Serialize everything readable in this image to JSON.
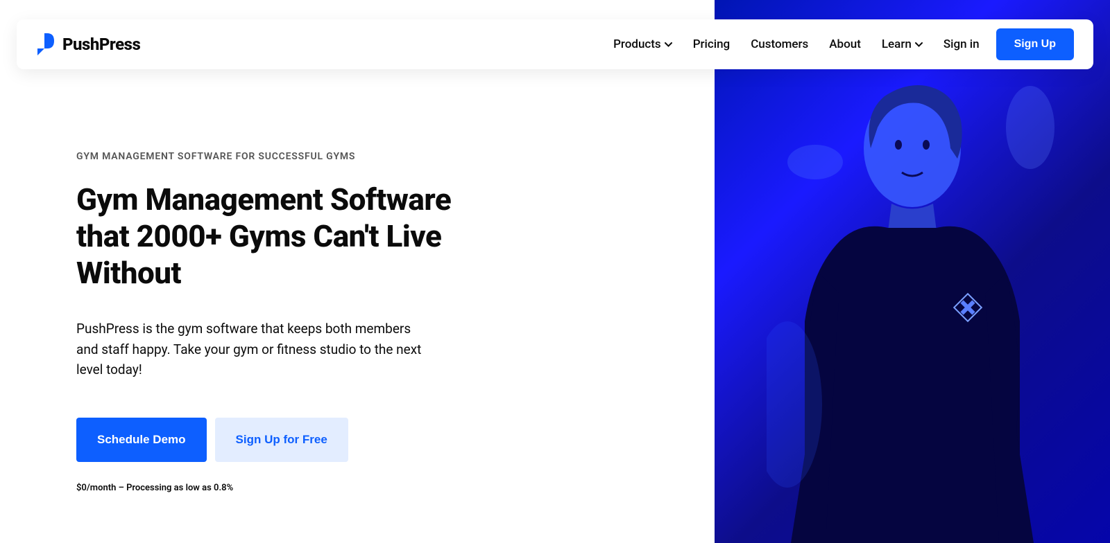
{
  "brand": {
    "name": "PushPress"
  },
  "nav": {
    "products": "Products",
    "pricing": "Pricing",
    "customers": "Customers",
    "about": "About",
    "learn": "Learn",
    "signin": "Sign in",
    "signup": "Sign Up"
  },
  "hero": {
    "eyebrow": "GYM MANAGEMENT SOFTWARE FOR SUCCESSFUL GYMS",
    "headline": "Gym Management Software that 2000+ Gyms Can't Live Without",
    "description": "PushPress is the gym software that keeps both members and staff happy. Take your gym or fitness studio to the next level today!",
    "cta_primary": "Schedule Demo",
    "cta_secondary": "Sign Up for Free",
    "pricing_note": "$0/month – Processing as low as 0.8%"
  }
}
